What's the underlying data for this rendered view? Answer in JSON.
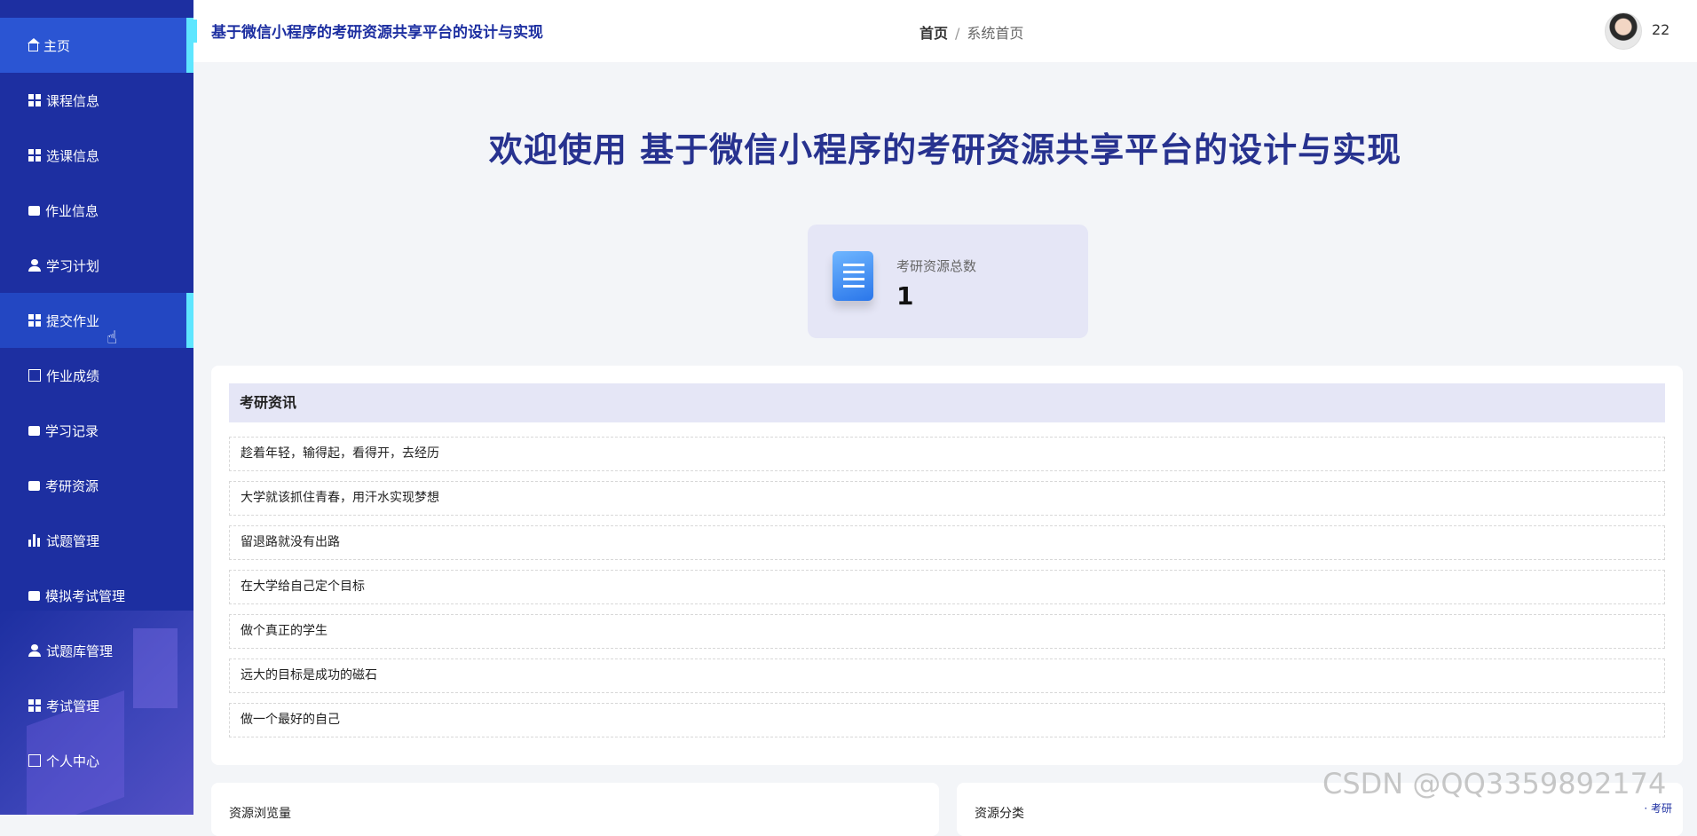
{
  "app": {
    "title": "基于微信小程序的考研资源共享平台的设计与实现"
  },
  "breadcrumb": {
    "home": "首页",
    "separator": "/",
    "current": "系统首页"
  },
  "user": {
    "id": "22"
  },
  "sidebar": {
    "items": [
      {
        "label": "主页",
        "icon": "home-icon"
      },
      {
        "label": "课程信息",
        "icon": "grid-icon"
      },
      {
        "label": "选课信息",
        "icon": "grid-icon"
      },
      {
        "label": "作业信息",
        "icon": "folder-icon"
      },
      {
        "label": "学习计划",
        "icon": "user-icon"
      },
      {
        "label": "提交作业",
        "icon": "grid-icon"
      },
      {
        "label": "作业成绩",
        "icon": "chart-icon"
      },
      {
        "label": "学习记录",
        "icon": "monitor-icon"
      },
      {
        "label": "考研资源",
        "icon": "clipboard-icon"
      },
      {
        "label": "试题管理",
        "icon": "bar-chart-icon"
      },
      {
        "label": "模拟考试管理",
        "icon": "stamp-icon"
      },
      {
        "label": "试题库管理",
        "icon": "user-icon"
      },
      {
        "label": "考试管理",
        "icon": "grid-icon"
      },
      {
        "label": "个人中心",
        "icon": "calendar-icon"
      }
    ]
  },
  "welcome": {
    "text": "欢迎使用 基于微信小程序的考研资源共享平台的设计与实现"
  },
  "stat": {
    "label": "考研资源总数",
    "value": "1"
  },
  "news": {
    "title": "考研资讯",
    "items": [
      "趁着年轻，输得起，看得开，去经历",
      "大学就该抓住青春，用汗水实现梦想",
      "留退路就没有出路",
      "在大学给自己定个目标",
      "做个真正的学生",
      "远大的目标是成功的磁石",
      "做一个最好的自己"
    ]
  },
  "bottom": {
    "views_title": "资源浏览量",
    "category_title": "资源分类",
    "category_legend": "· 考研"
  },
  "watermark": "CSDN @QQ3359892174",
  "colors": {
    "sidebar": "#1d2fa1",
    "active": "#2b55d3",
    "accent": "#5ee6ff",
    "title": "#27328f"
  }
}
